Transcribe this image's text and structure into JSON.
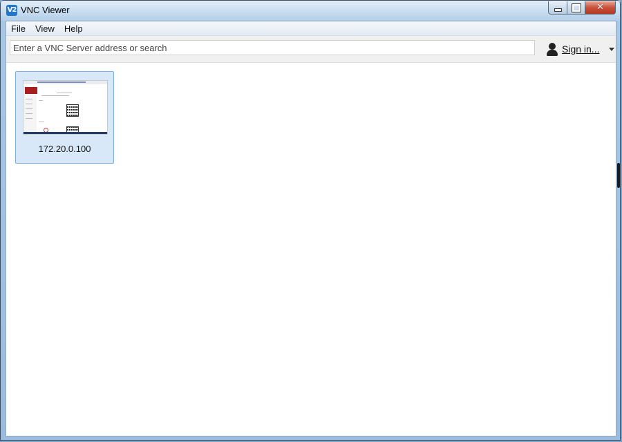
{
  "window": {
    "title": "VNC Viewer",
    "app_icon_text": "V2",
    "close_glyph": "✕"
  },
  "menu": {
    "items": [
      {
        "label": "File"
      },
      {
        "label": "View"
      },
      {
        "label": "Help"
      }
    ]
  },
  "toolbar": {
    "search_placeholder": "Enter a VNC Server address or search",
    "search_value": "",
    "signin_label": "Sign in..."
  },
  "connections": [
    {
      "address": "172.20.0.100",
      "selected": true
    }
  ],
  "colors": {
    "accent": "#2277cc",
    "card_selected_bg": "#d8e8f9",
    "card_selected_border": "#7fb0e4"
  }
}
